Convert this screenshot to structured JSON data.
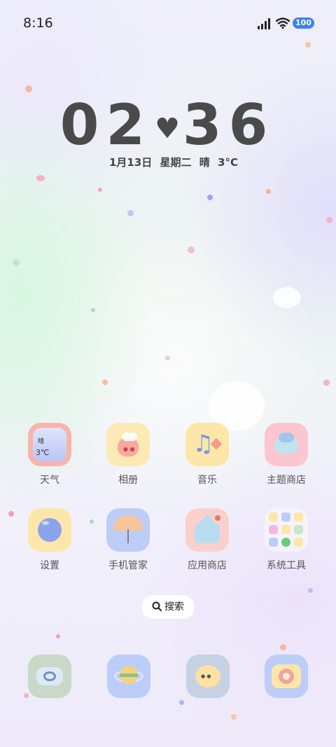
{
  "status_bar": {
    "time": "8:16",
    "battery": "100"
  },
  "clock": {
    "hour": "02",
    "minute": "36"
  },
  "date_line": {
    "date": "1月13日",
    "weekday": "星期二",
    "weather": "晴",
    "temp": "3°C"
  },
  "apps": [
    {
      "label": "天气",
      "icon": "weather-icon"
    },
    {
      "label": "相册",
      "icon": "gallery-icon"
    },
    {
      "label": "音乐",
      "icon": "music-icon"
    },
    {
      "label": "主题商店",
      "icon": "theme-store-icon"
    },
    {
      "label": "设置",
      "icon": "settings-icon"
    },
    {
      "label": "手机管家",
      "icon": "phone-manager-icon"
    },
    {
      "label": "应用商店",
      "icon": "app-store-icon"
    },
    {
      "label": "系统工具",
      "icon": "system-tools-folder-icon"
    }
  ],
  "weather_icon": {
    "condition": "晴",
    "temp": "3℃"
  },
  "search": {
    "label": "搜索"
  },
  "dock": [
    {
      "icon": "phone-icon"
    },
    {
      "icon": "messages-icon"
    },
    {
      "icon": "browser-icon"
    },
    {
      "icon": "camera-icon"
    }
  ],
  "colors": {
    "battery": "#3b82f6",
    "clock": "#4a4a4a"
  }
}
